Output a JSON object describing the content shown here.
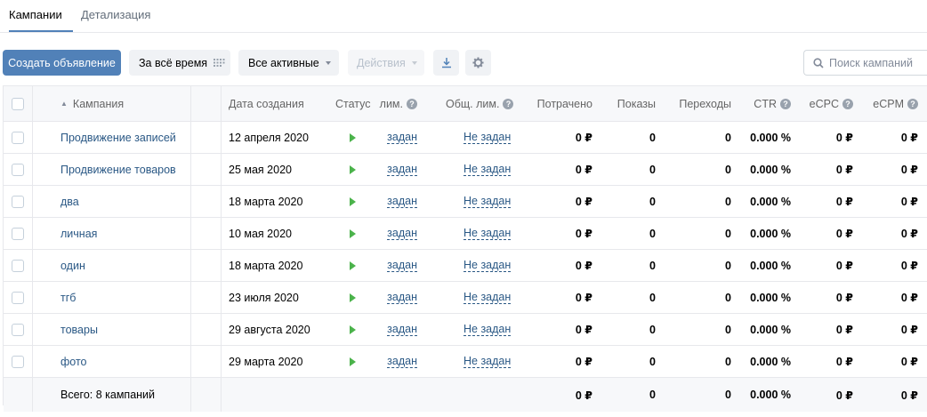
{
  "tabs": [
    {
      "label": "Кампании"
    },
    {
      "label": "Детализация"
    }
  ],
  "toolbar": {
    "create_label": "Создать объявление",
    "period_label": "За всё время",
    "status_filter_label": "Все активные",
    "actions_label": "Действия",
    "search_placeholder": "Поиск кампаний"
  },
  "table": {
    "headers": {
      "campaign": "Кампания",
      "created": "Дата создания",
      "status": "Статус",
      "day_limit": "лим.",
      "total_limit": "Общ. лим.",
      "spent": "Потрачено",
      "impressions": "Показы",
      "clicks": "Переходы",
      "ctr": "CTR",
      "ecpc": "eCPC",
      "ecpm": "eCPM"
    },
    "rows": [
      {
        "name": "Продвижение записей",
        "date": "12 апреля 2020",
        "day_limit": "задан",
        "total_limit": "Не задан",
        "spent": "0 ₽",
        "impressions": "0",
        "clicks": "0",
        "ctr": "0.000 %",
        "ecpc": "0 ₽",
        "ecpm": "0 ₽"
      },
      {
        "name": "Продвижение товаров",
        "date": "25 мая 2020",
        "day_limit": "задан",
        "total_limit": "Не задан",
        "spent": "0 ₽",
        "impressions": "0",
        "clicks": "0",
        "ctr": "0.000 %",
        "ecpc": "0 ₽",
        "ecpm": "0 ₽"
      },
      {
        "name": "два",
        "date": "18 марта 2020",
        "day_limit": "задан",
        "total_limit": "Не задан",
        "spent": "0 ₽",
        "impressions": "0",
        "clicks": "0",
        "ctr": "0.000 %",
        "ecpc": "0 ₽",
        "ecpm": "0 ₽"
      },
      {
        "name": "личная",
        "date": "10 мая 2020",
        "day_limit": "задан",
        "total_limit": "Не задан",
        "spent": "0 ₽",
        "impressions": "0",
        "clicks": "0",
        "ctr": "0.000 %",
        "ecpc": "0 ₽",
        "ecpm": "0 ₽"
      },
      {
        "name": "один",
        "date": "18 марта 2020",
        "day_limit": "задан",
        "total_limit": "Не задан",
        "spent": "0 ₽",
        "impressions": "0",
        "clicks": "0",
        "ctr": "0.000 %",
        "ecpc": "0 ₽",
        "ecpm": "0 ₽"
      },
      {
        "name": "тгб",
        "date": "23 июля 2020",
        "day_limit": "задан",
        "total_limit": "Не задан",
        "spent": "0 ₽",
        "impressions": "0",
        "clicks": "0",
        "ctr": "0.000 %",
        "ecpc": "0 ₽",
        "ecpm": "0 ₽"
      },
      {
        "name": "товары",
        "date": "29 августа 2020",
        "day_limit": "задан",
        "total_limit": "Не задан",
        "spent": "0 ₽",
        "impressions": "0",
        "clicks": "0",
        "ctr": "0.000 %",
        "ecpc": "0 ₽",
        "ecpm": "0 ₽"
      },
      {
        "name": "фото",
        "date": "29 марта 2020",
        "day_limit": "задан",
        "total_limit": "Не задан",
        "spent": "0 ₽",
        "impressions": "0",
        "clicks": "0",
        "ctr": "0.000 %",
        "ecpc": "0 ₽",
        "ecpm": "0 ₽"
      }
    ],
    "footer": {
      "label": "Всего: 8 кампаний",
      "spent": "0 ₽",
      "impressions": "0",
      "clicks": "0",
      "ctr": "0.000 %",
      "ecpc": "0 ₽",
      "ecpm": "0 ₽"
    }
  },
  "icons": {
    "period": "calendar-grid-icon",
    "download": "download-icon",
    "settings": "gear-icon",
    "search": "search-icon",
    "status_active": "play-icon",
    "help": "question-icon",
    "sort": "sort-up-icon"
  },
  "colors": {
    "accent": "#5181b8",
    "link": "#2a5885",
    "status_active": "#4bb34b"
  }
}
